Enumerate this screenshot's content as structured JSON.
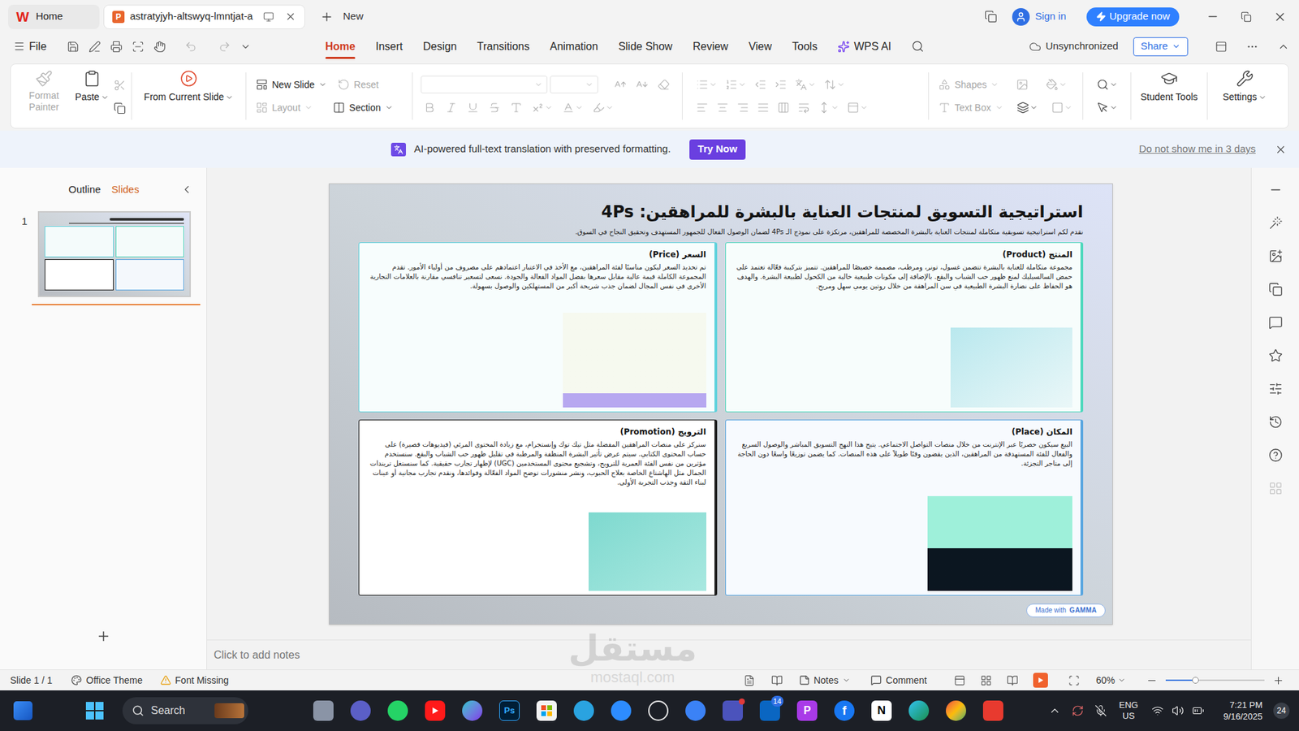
{
  "titlebar": {
    "tabs": [
      {
        "label": "Home",
        "glyph": "W",
        "selected": false
      },
      {
        "label": "astratyjyh-altswyq-lmntjat-a",
        "glyph": "P",
        "selected": true
      }
    ],
    "new_tab": "New",
    "sign_in": "Sign in",
    "upgrade": "Upgrade now"
  },
  "menubar": {
    "file": "File",
    "tabs": [
      {
        "label": "Home",
        "kind": "plain",
        "selected": true
      },
      {
        "label": "Insert",
        "kind": "plain",
        "selected": false
      },
      {
        "label": "Design",
        "kind": "plain",
        "selected": false
      },
      {
        "label": "Transitions",
        "kind": "plain",
        "selected": false
      },
      {
        "label": "Animation",
        "kind": "plain",
        "selected": false
      },
      {
        "label": "Slide Show",
        "kind": "plain",
        "selected": false
      },
      {
        "label": "Review",
        "kind": "plain",
        "selected": false
      },
      {
        "label": "View",
        "kind": "plain",
        "selected": false
      },
      {
        "label": "Tools",
        "kind": "plain",
        "selected": false
      },
      {
        "label": "WPS AI",
        "kind": "ai",
        "selected": false
      }
    ],
    "sync": "Unsynchronized",
    "share": "Share"
  },
  "ribbon": {
    "format_painter": {
      "label": "Format Painter",
      "disabled": true
    },
    "paste": {
      "label": "Paste",
      "disabled": false
    },
    "cut_disabled": true,
    "from_current": {
      "label": "From Current Slide",
      "disabled": false
    },
    "new_slide": {
      "label": "New Slide",
      "disabled": false
    },
    "reset": {
      "label": "Reset",
      "disabled": true
    },
    "layout": {
      "label": "Layout",
      "disabled": true
    },
    "section": {
      "label": "Section",
      "disabled": false
    },
    "formatting_disabled": true,
    "paragraph_disabled": true,
    "shapes": {
      "label": "Shapes",
      "disabled": true
    },
    "text_box": {
      "label": "Text Box",
      "disabled": true
    },
    "student_tools": {
      "label": "Student Tools",
      "disabled": false
    },
    "settings": {
      "label": "Settings",
      "disabled": false
    }
  },
  "notice": {
    "message": "AI-powered full-text translation with preserved formatting.",
    "action": "Try Now",
    "dismiss": "Do not show me in 3 days"
  },
  "panel": {
    "tabs": [
      {
        "label": "Outline",
        "selected": false
      },
      {
        "label": "Slides",
        "selected": true
      }
    ],
    "slides": [
      {
        "number": "1",
        "selected": true
      }
    ]
  },
  "slide": {
    "title": "استراتيجية التسويق لمنتجات العناية بالبشرة للمراهقين: 4Ps",
    "subtitle": "نقدم لكم استراتيجية تسويقية متكاملة لمنتجات العناية بالبشرة المخصصة للمراهقين، مرتكزة على نموذج الـ 4Ps لضمان الوصول الفعال للجمهور المستهدف وتحقيق النجاح في السوق.",
    "cards": [
      {
        "heading": "المنتج (Product)",
        "color": "#4fd8bd",
        "body": "مجموعة متكاملة للعناية بالبشرة تتضمن غسول، تونر، ومرطب، مصممة خصيصًا للمراهقين. تتميز بتركيبة فعّالة تعتمد على حمض السالسيليك لمنع ظهور حب الشباب والبقع. بالإضافة إلى مكونات طبيعية خالية من الكحول لطبيعة البشرة. والهدف هو الحفاظ على نضارة البشرة الطبيعية في سن المراهقة من خلال روتين يومي سهل ومريح."
      },
      {
        "heading": "السعر (Price)",
        "color": "#5fd2dc",
        "body": "تم تحديد السعر ليكون مناسبًا لفئة المراهقين، مع الأخذ في الاعتبار اعتمادهم على مصروف من أولياء الأمور. تقدم المجموعة الكاملة قيمة عالية مقابل سعرها بفضل المواد الفعالة والجودة. نسعى لتسعير تنافسي مقارنة بالعلامات التجارية الأخرى في نفس المجال لضمان جذب شريحة أكبر من المستهلكين والوصول بسهولة."
      },
      {
        "heading": "المكان (Place)",
        "color": "#5aa6e0",
        "body": "البيع سيكون حصريًا عبر الإنترنت من خلال منصات التواصل الاجتماعي. يتيح هذا النهج التسويق المباشر والوصول السريع والفعال للفئة المستهدفة من المراهقين، الذين يقضون وقتًا طويلاً على هذه المنصات. كما يضمن توزيعًا واسعًا دون الحاجة إلى متاجر التجزئة."
      },
      {
        "heading": "الترويج (Promotion)",
        "color": "#1e1e1e",
        "body": "سنركز على منصات المراهقين المفضلة مثل تيك توك وإنستجرام، مع زيادة المحتوى المرئي (فيديوهات قصيرة) على حساب المحتوى الكتابي. سيتم عرض تأثير البشرة المنظفة والمرطبة في تقليل ظهور حب الشباب والبقع. سنستخدم مؤثرين من نفس الفئة العمرية للترويج، وتشجيع محتوى المستخدمين (UGC) لإظهار تجارب حقيقية. كما سنستغل تريندات الجمال مثل الهاشتاغ الخاصة بعلاج الحبوب، ونشر منشورات توضح المواد الفعّالة وفوائدها، ونقدم تجارب مجانية أو عينات لبناء الثقة وجذب التجربة الأولى."
      }
    ],
    "badge_prefix": "Made with",
    "badge_brand": "GAMMA"
  },
  "notes": {
    "placeholder": "Click to add notes"
  },
  "statusbar": {
    "slide": "Slide 1 / 1",
    "theme": "Office Theme",
    "font_warning": "Font Missing",
    "notes": "Notes",
    "comment": "Comment",
    "zoom": "60%",
    "zoom_level": 0.3
  },
  "watermark": {
    "arabic": "مستقل",
    "latin": "mostaql.com"
  },
  "taskbar": {
    "search": "Search",
    "photoshop": "Ps",
    "picsart": "P",
    "facebook": "f",
    "notion": "N",
    "linkedin_badge": "14",
    "language": "ENG",
    "region": "US",
    "time": "7:21 PM",
    "date": "9/16/2025",
    "notifications": "24"
  }
}
